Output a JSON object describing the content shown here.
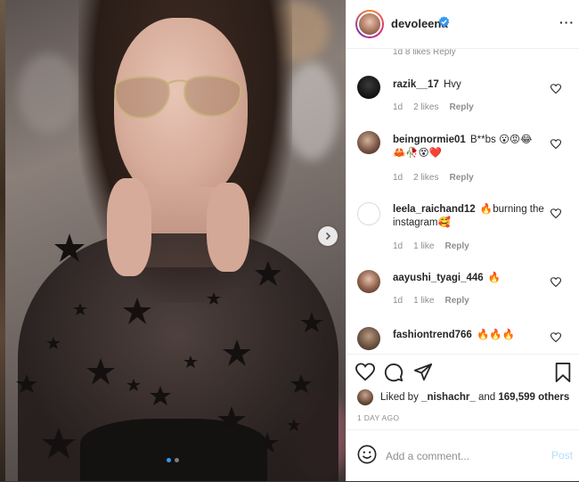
{
  "post": {
    "author": "devoleena",
    "verified": true,
    "photo": {
      "slide_count": 2,
      "active_slide": 1
    }
  },
  "comments_cut": {
    "text": "1d   8 likes   Reply"
  },
  "comments": [
    {
      "username": "razik__17",
      "text": "Hvy",
      "emoji": "",
      "time": "1d",
      "likes": "2 likes",
      "reply": "Reply"
    },
    {
      "username": "beingnormie01",
      "text": "B**bs 😮😡😂",
      "emoji": "🦀🥀😵❤️",
      "time": "1d",
      "likes": "2 likes",
      "reply": "Reply"
    },
    {
      "username": "leela_raichand12",
      "text": "🔥burning the instagram🥰",
      "emoji": "",
      "time": "1d",
      "likes": "1 like",
      "reply": "Reply"
    },
    {
      "username": "aayushi_tyagi_446",
      "text": "🔥",
      "emoji": "",
      "time": "1d",
      "likes": "1 like",
      "reply": "Reply"
    },
    {
      "username": "fashiontrend766",
      "text": "🔥🔥🔥",
      "emoji": "",
      "time": "",
      "likes": "",
      "reply": ""
    }
  ],
  "actions": {
    "liked_prefix": "Liked by ",
    "liked_user": "_nishachr_",
    "liked_and": " and ",
    "liked_count": "169,599 others",
    "time_ago": "1 DAY AGO"
  },
  "comment_box": {
    "placeholder": "Add a comment...",
    "post_label": "Post"
  },
  "colors": {
    "accent": "#3797f0",
    "text": "#262626",
    "muted": "#8e8e8e",
    "post_disabled": "#b2dffc"
  },
  "icons": [
    "chevron-right-icon",
    "verified-badge-icon",
    "more-icon",
    "heart-icon",
    "comment-icon",
    "share-icon",
    "bookmark-icon",
    "emoji-icon"
  ]
}
